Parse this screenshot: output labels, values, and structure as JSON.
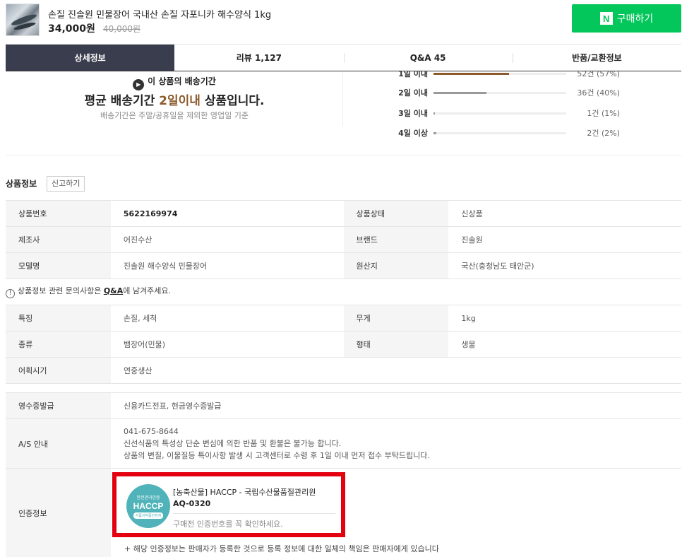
{
  "product": {
    "title": "손질 진솔원 민물장어 국내산 손질 자포니카 해수양식 1kg",
    "price": "34,000원",
    "original_price": "40,000원",
    "buy_logo": "N",
    "buy_label": "구매하기"
  },
  "tabs": [
    {
      "label": "상세정보",
      "active": true
    },
    {
      "label": "리뷰 1,127",
      "active": false
    },
    {
      "label": "Q&A 45",
      "active": false
    },
    {
      "label": "반품/교환정보",
      "active": false
    }
  ],
  "delivery": {
    "icon": "truck-icon",
    "heading": "이 상품의 배송기간",
    "main_prefix": "평균 배송기간 ",
    "main_highlight": "2일이내",
    "main_suffix": " 상품입니다.",
    "sub": "배송기간은 주말/공휴일을 제외한 영업일 기준",
    "distribution": [
      {
        "label": "1일 이내",
        "count": "52건 (57%)",
        "ratio": 0.57
      },
      {
        "label": "2일 이내",
        "count": "36건 (40%)",
        "ratio": 0.4
      },
      {
        "label": "3일 이내",
        "count": "1건 (1%)",
        "ratio": 0.01
      },
      {
        "label": "4일 이상",
        "count": "2건 (2%)",
        "ratio": 0.02
      }
    ]
  },
  "info": {
    "title": "상품정보",
    "report_label": "신고하기",
    "basic": [
      {
        "k1": "상품번호",
        "v1": "5622169974",
        "k2": "상품상태",
        "v2": "신상품"
      },
      {
        "k1": "제조사",
        "v1": "어진수산",
        "k2": "브랜드",
        "v2": "진솔원"
      },
      {
        "k1": "모델명",
        "v1": "진솔원 해수양식 민물장어",
        "k2": "원산지",
        "v2": "국산(충청남도 태안군)"
      }
    ],
    "note_icon": "!",
    "note_prefix": "상품정보 관련 문의사항은 ",
    "note_link": "Q&A",
    "note_suffix": "에 남겨주세요.",
    "attrs": [
      {
        "k1": "특징",
        "v1": "손질, 세척",
        "k2": "무게",
        "v2": "1kg"
      },
      {
        "k1": "종류",
        "v1": "뱀장어(민물)",
        "k2": "형태",
        "v2": "생물"
      }
    ],
    "season_key": "어획시기",
    "season_val": "연중생산",
    "receipt_key": "영수증발급",
    "receipt_val": "신용카드전표, 현금영수증발급",
    "as_key": "A/S 안내",
    "as_lines": [
      "041-675-8644",
      "신선식품의 특성상 단순 변심에 의한 반품 및 환불은 불가능 합니다.",
      "상품의 변질, 이물질등 특이사항 발생 시 고객센터로 수령 후 1일 이내 먼저 접수 부탁드립니다."
    ],
    "cert_key": "인증정보",
    "cert": {
      "logo_top": "안전관리인증",
      "logo_mid": "HACCP",
      "logo_bot": "식품의약품안전처",
      "org": "[농축산물] HACCP - 국립수산물품질관리원",
      "number": "AQ-0320",
      "hint": "구매전 인증번호를 꼭 확인하세요."
    },
    "footnote": "+ 해당 인증정보는 판매자가 등록한 것으로 등록 정보에 대한 일체의 책임은 판매자에게 있습니다"
  },
  "colors": {
    "brand_green": "#03c75a",
    "tab_active": "#3a3d4d",
    "highlight": "#8b5a2b",
    "cert_border": "#e3000f"
  }
}
